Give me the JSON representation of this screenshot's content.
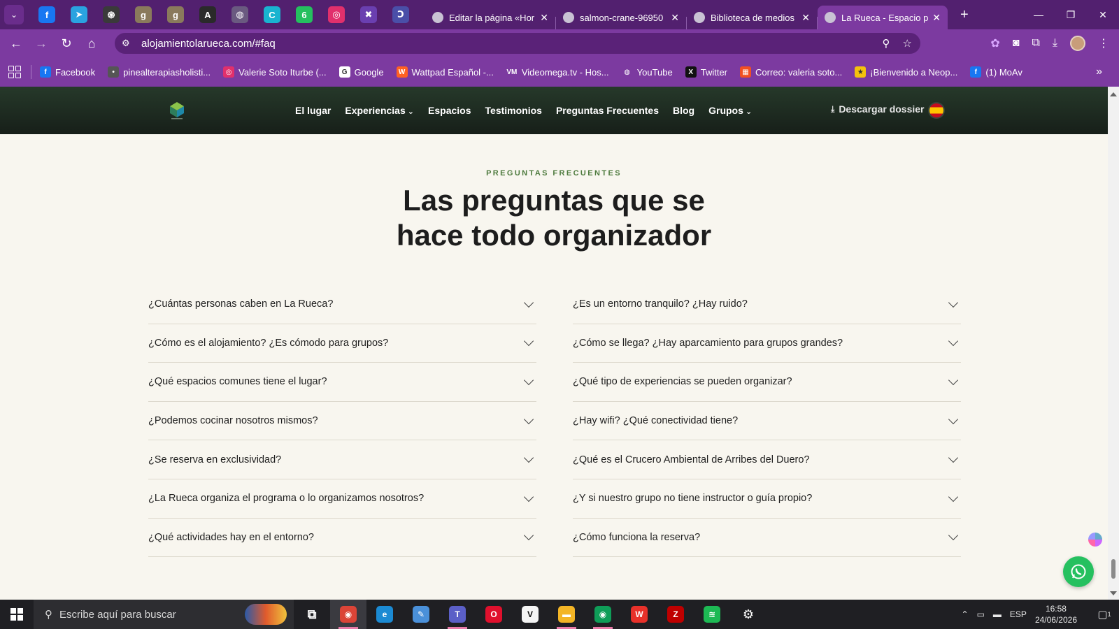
{
  "browser": {
    "pinned_tabs": [
      {
        "icon": "facebook-icon",
        "color": "#1877f2",
        "glyph": "f"
      },
      {
        "icon": "telegram-icon",
        "color": "#2aa3e0",
        "glyph": "➤"
      },
      {
        "icon": "chatgpt-icon",
        "color": "#3a3a3a",
        "glyph": "֍"
      },
      {
        "icon": "goodreads-icon",
        "color": "#8a7a5c",
        "glyph": "g"
      },
      {
        "icon": "goodreads-icon",
        "color": "#8a7a5c",
        "glyph": "g"
      },
      {
        "icon": "font-a-icon",
        "color": "#2a2a2a",
        "glyph": "A"
      },
      {
        "icon": "globe-icon",
        "color": "#6a5a80",
        "glyph": "◍"
      },
      {
        "icon": "canva-icon",
        "color": "#19b4d0",
        "glyph": "C"
      },
      {
        "icon": "whatsapp-6-icon",
        "color": "#25c05f",
        "glyph": "6"
      },
      {
        "icon": "instagram-icon",
        "color": "#e1306c",
        "glyph": "◎"
      },
      {
        "icon": "puzzle-icon",
        "color": "#6a3fb0",
        "glyph": "✖"
      },
      {
        "icon": "loader-icon",
        "color": "#4a4fa8",
        "glyph": "Ↄ"
      }
    ],
    "tabs": [
      {
        "title": "Editar la página «Hor",
        "active": false
      },
      {
        "title": "salmon-crane-96950",
        "active": false
      },
      {
        "title": "Biblioteca de medios",
        "active": false
      },
      {
        "title": "La Rueca - Espacio p",
        "active": true
      }
    ],
    "new_tab_label": "+",
    "url": "alojamientolarueca.com/#faq",
    "bookmarks": [
      {
        "label": "Facebook",
        "icon": "facebook-icon",
        "color": "#1877f2",
        "glyph": "f"
      },
      {
        "label": "pinealterapiasholisti...",
        "icon": "dot-icon",
        "color": "#555555",
        "glyph": "•"
      },
      {
        "label": "Valerie Soto Iturbe (...",
        "icon": "instagram-icon",
        "color": "#e1306c",
        "glyph": "◎"
      },
      {
        "label": "Google",
        "icon": "google-icon",
        "color": "#ffffff",
        "glyph": "G"
      },
      {
        "label": "Wattpad Español -...",
        "icon": "wattpad-icon",
        "color": "#ff6122",
        "glyph": "W"
      },
      {
        "label": "Videomega.tv - Hos...",
        "icon": "vm-icon",
        "color": "#7c3aa0",
        "glyph": "VM"
      },
      {
        "label": "YouTube",
        "icon": "globe-icon",
        "color": "#7c3aa0",
        "glyph": "◍"
      },
      {
        "label": "Twitter",
        "icon": "x-icon",
        "color": "#111111",
        "glyph": "X"
      },
      {
        "label": "Correo: valeria soto...",
        "icon": "microsoft-icon",
        "color": "#f25022",
        "glyph": "▦"
      },
      {
        "label": "¡Bienvenido a Neop...",
        "icon": "star-icon",
        "color": "#f4c20d",
        "glyph": "★"
      },
      {
        "label": "(1) MoAv",
        "icon": "facebook-icon",
        "color": "#1877f2",
        "glyph": "f"
      }
    ]
  },
  "site": {
    "nav": [
      {
        "label": "El lugar",
        "dropdown": false
      },
      {
        "label": "Experiencias",
        "dropdown": true
      },
      {
        "label": "Espacios",
        "dropdown": false
      },
      {
        "label": "Testimonios",
        "dropdown": false
      },
      {
        "label": "Preguntas Frecuentes",
        "dropdown": false
      },
      {
        "label": "Blog",
        "dropdown": false
      },
      {
        "label": "Grupos",
        "dropdown": true
      }
    ],
    "download_label": "Descargar dossier",
    "eyebrow": "PREGUNTAS FRECUENTES",
    "heading_line1": "Las preguntas que se",
    "heading_line2": "hace todo organizador",
    "faq_left": [
      "¿Cuántas personas caben en La Rueca?",
      "¿Cómo es el alojamiento? ¿Es cómodo para grupos?",
      "¿Qué espacios comunes tiene el lugar?",
      "¿Podemos cocinar nosotros mismos?",
      "¿Se reserva en exclusividad?",
      "¿La Rueca organiza el programa o lo organizamos nosotros?",
      "¿Qué actividades hay en el entorno?"
    ],
    "faq_right": [
      "¿Es un entorno tranquilo? ¿Hay ruido?",
      "¿Cómo se llega? ¿Hay aparcamiento para grupos grandes?",
      "¿Qué tipo de experiencias se pueden organizar?",
      "¿Hay wifi? ¿Qué conectividad tiene?",
      "¿Qué es el Crucero Ambiental de Arribes del Duero?",
      "¿Y si nuestro grupo no tiene instructor o guía propio?",
      "¿Cómo funciona la reserva?"
    ],
    "accent_green": "#4d7a3d"
  },
  "taskbar": {
    "search_placeholder": "Escribe aquí para buscar",
    "apps": [
      {
        "icon": "task-view-icon",
        "color": "transparent",
        "glyph": "⧉",
        "active": false,
        "open": false
      },
      {
        "icon": "chrome-icon",
        "color": "#db4437",
        "glyph": "◉",
        "active": true,
        "open": true
      },
      {
        "icon": "edge-icon",
        "color": "#1b8ad3",
        "glyph": "e",
        "active": false,
        "open": false
      },
      {
        "icon": "paint-icon",
        "color": "#4a90d9",
        "glyph": "✎",
        "active": false,
        "open": false
      },
      {
        "icon": "teams-icon",
        "color": "#5b5fc7",
        "glyph": "T",
        "active": false,
        "open": true
      },
      {
        "icon": "opera-icon",
        "color": "#e0102d",
        "glyph": "O",
        "active": false,
        "open": false
      },
      {
        "icon": "vectorize-icon",
        "color": "#f5f5f5",
        "glyph": "V",
        "active": false,
        "open": false
      },
      {
        "icon": "file-explorer-icon",
        "color": "#f3b526",
        "glyph": "▬",
        "active": false,
        "open": true
      },
      {
        "icon": "chrome-profile-icon",
        "color": "#0f9d58",
        "glyph": "◉",
        "active": false,
        "open": true
      },
      {
        "icon": "wps-icon",
        "color": "#e8312a",
        "glyph": "W",
        "active": false,
        "open": false
      },
      {
        "icon": "filezilla-icon",
        "color": "#bf0000",
        "glyph": "Z",
        "active": false,
        "open": false
      },
      {
        "icon": "spotify-icon",
        "color": "#1db954",
        "glyph": "≋",
        "active": false,
        "open": false
      },
      {
        "icon": "settings-icon",
        "color": "transparent",
        "glyph": "⚙",
        "active": false,
        "open": false
      }
    ],
    "language": "ESP",
    "time": "16:58",
    "date": "24/06/2026",
    "notification_count": "1"
  }
}
